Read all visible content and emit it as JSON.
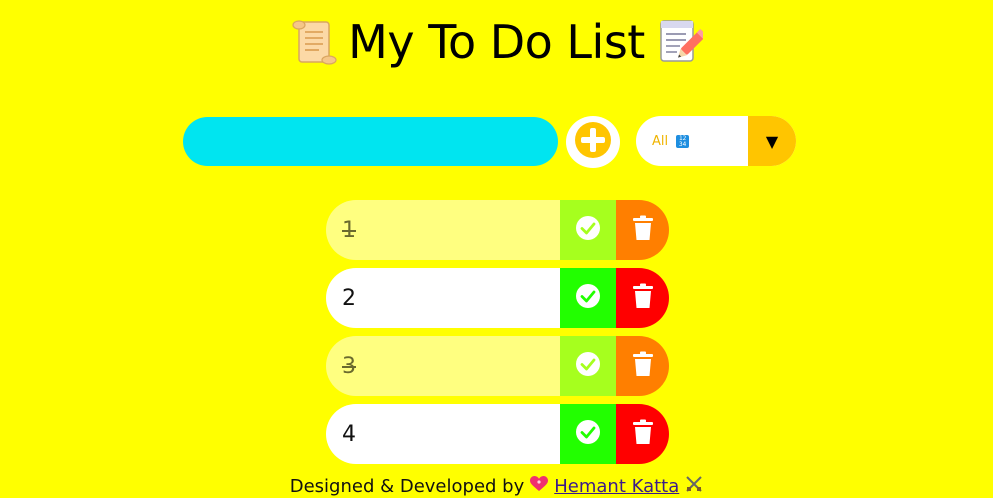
{
  "header": {
    "title": "My To Do List",
    "left_icon": "scroll-icon",
    "right_icon": "memo-pencil-icon"
  },
  "form": {
    "input_value": "",
    "input_placeholder": "",
    "add_icon": "plus-circle-icon",
    "filter_selected": "All",
    "filter_icon": "numbers-icon",
    "filter_caret": "▼"
  },
  "todos": [
    {
      "text": "1",
      "completed": true
    },
    {
      "text": "2",
      "completed": false
    },
    {
      "text": "3",
      "completed": true
    },
    {
      "text": "4",
      "completed": false
    }
  ],
  "footer": {
    "prefix": "Designed & Developed by",
    "author": "Hemant Katta",
    "heart_icon": "heart-icon",
    "swords_icon": "crossed-swords-icon"
  },
  "colors": {
    "background": "#ffff00",
    "input": "#00e5f0",
    "accent": "#ffc500",
    "check": "#22ff00",
    "check_done": "#a6ff1e",
    "trash": "#ff0000",
    "trash_done": "#ff7f00",
    "item_done": "#ffff80"
  }
}
